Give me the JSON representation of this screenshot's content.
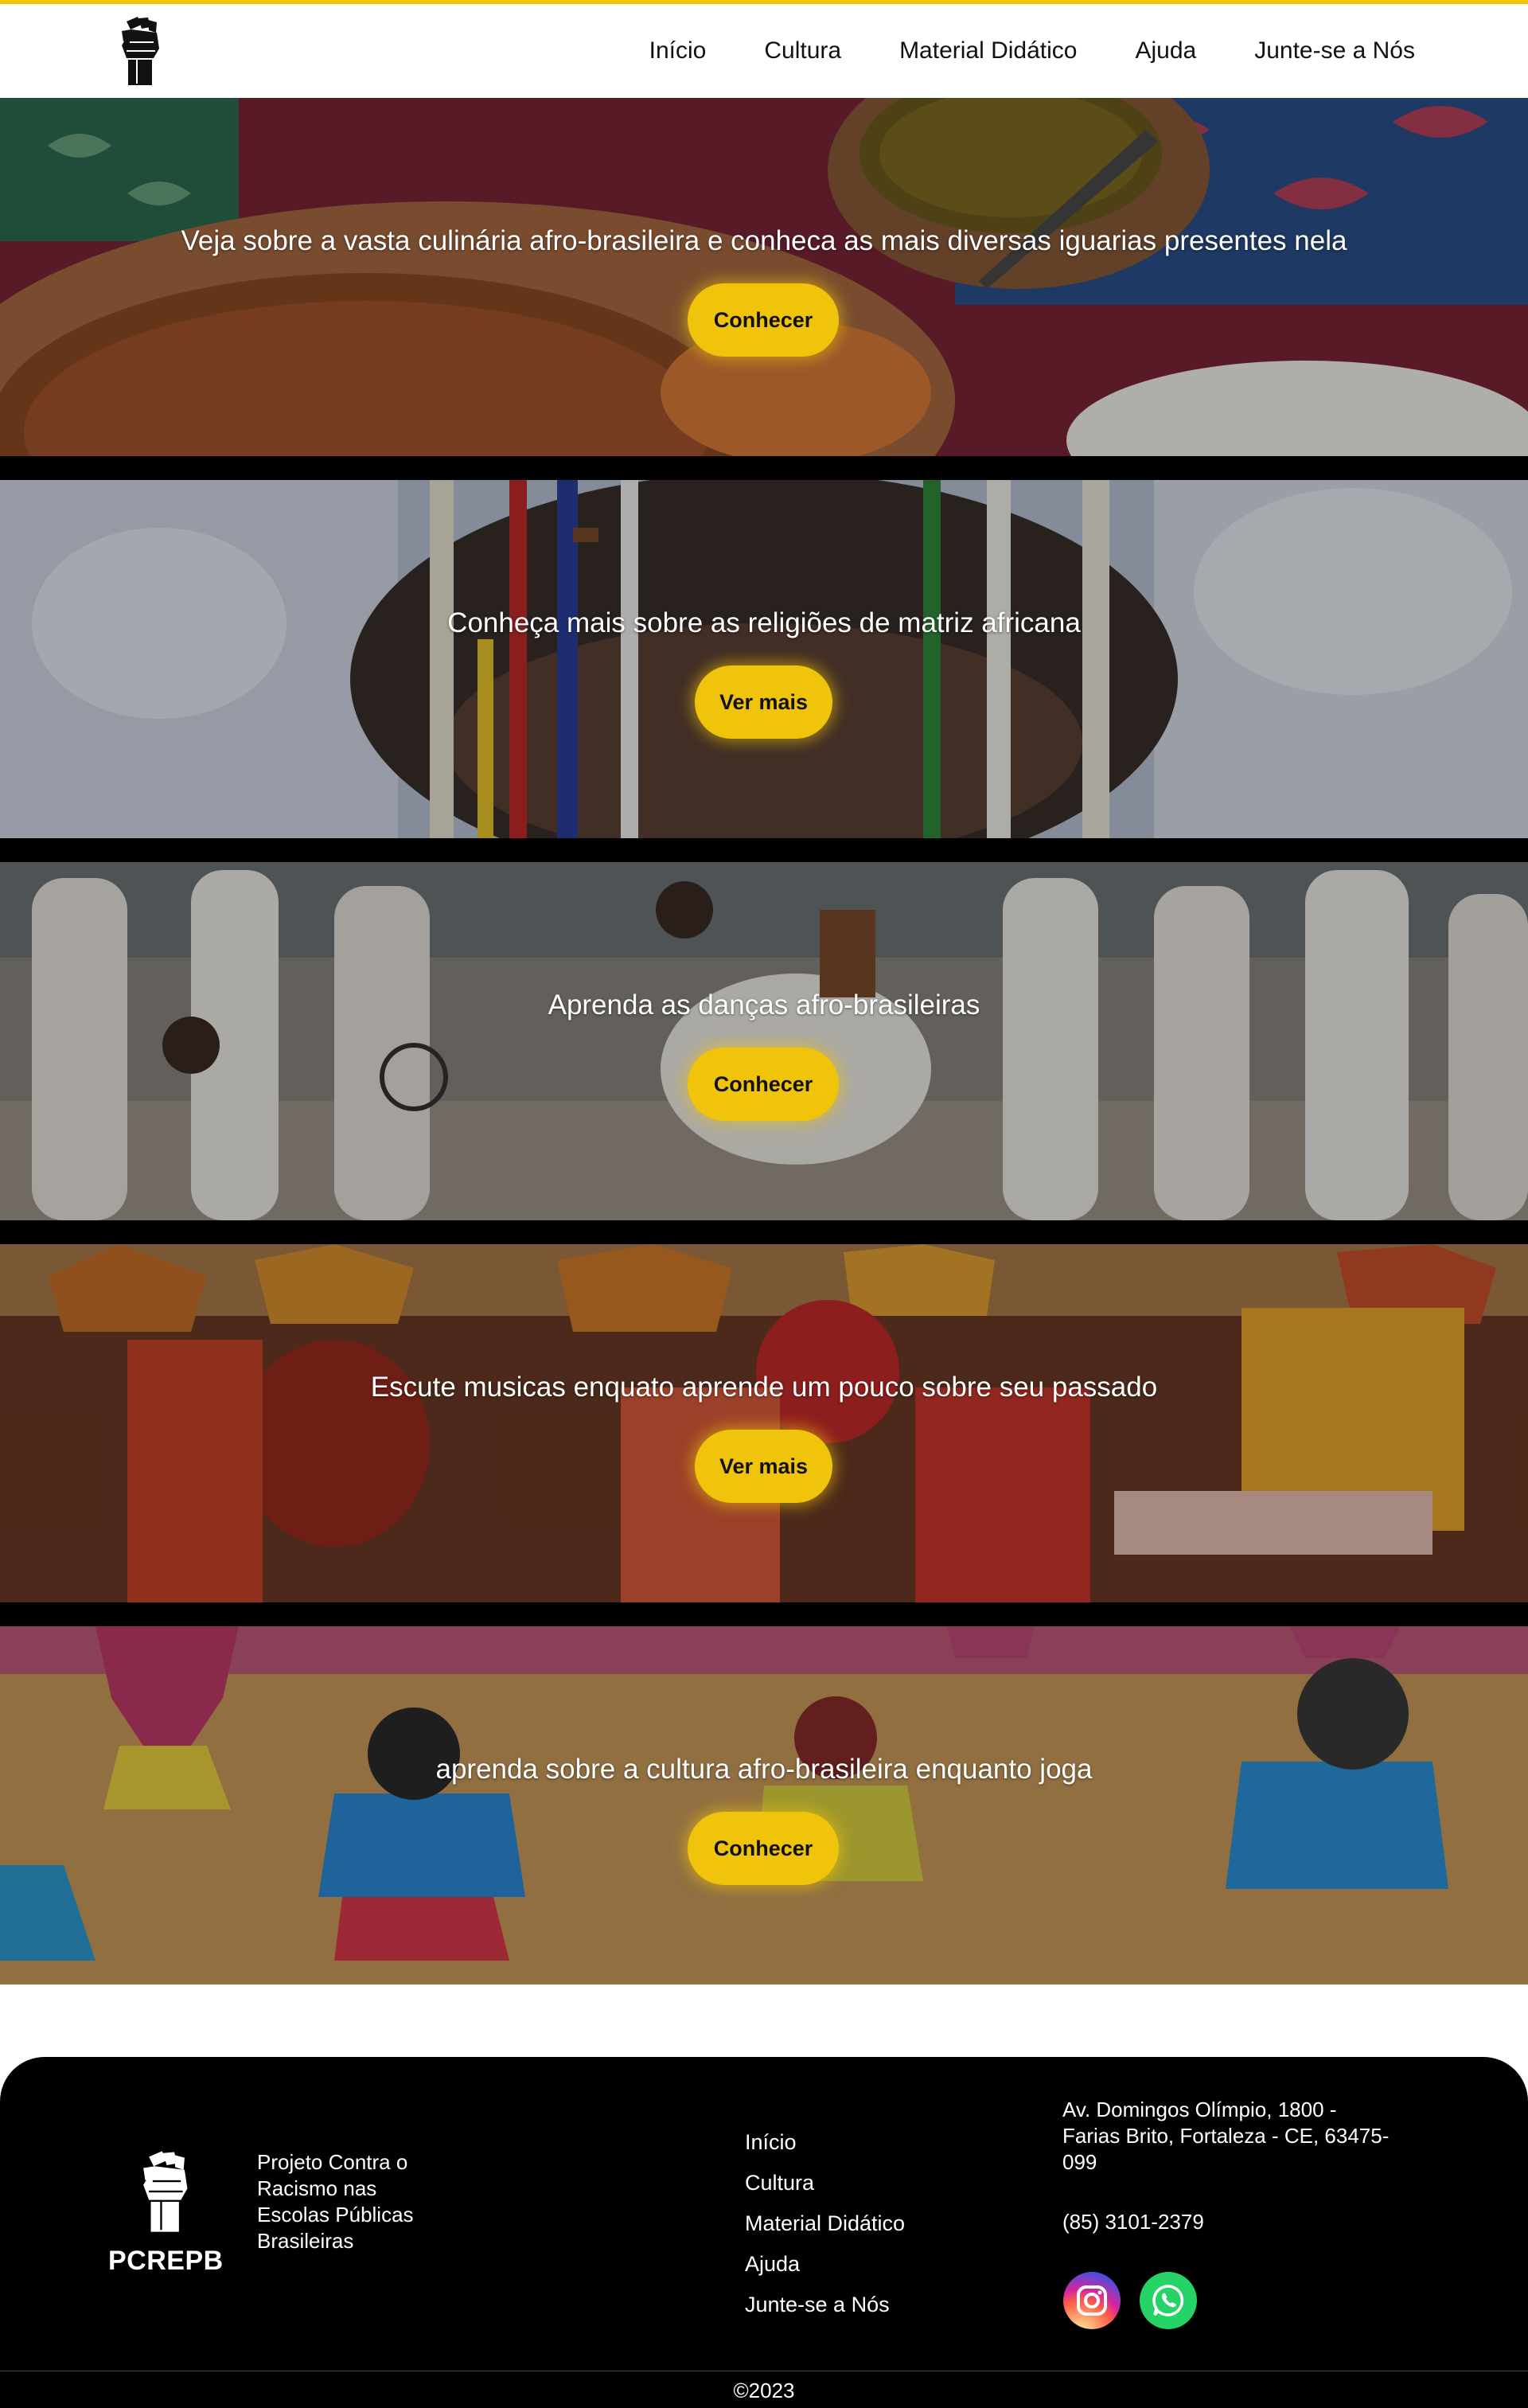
{
  "nav": {
    "items": [
      {
        "label": "Início"
      },
      {
        "label": "Cultura"
      },
      {
        "label": "Material Didático"
      },
      {
        "label": "Ajuda"
      },
      {
        "label": "Junte-se a Nós"
      }
    ]
  },
  "banners": [
    {
      "caption": "Veja sobre a vasta culinária afro-brasileira e conheca as mais diversas iguarias presentes nela",
      "button": "Conhecer"
    },
    {
      "caption": "Conheça mais sobre as religiões de matriz africana",
      "button": "Ver mais"
    },
    {
      "caption": "Aprenda as danças afro-brasileiras",
      "button": "Conhecer"
    },
    {
      "caption": "Escute musicas enquato aprende um pouco sobre seu passado",
      "button": "Ver mais"
    },
    {
      "caption": "aprenda sobre a cultura afro-brasileira enquanto joga",
      "button": "Conhecer"
    }
  ],
  "footer": {
    "brand": "PCREPB",
    "tagline": "Projeto Contra o Racismo nas Escolas Públicas Brasileiras",
    "links": [
      {
        "label": "Início"
      },
      {
        "label": "Cultura"
      },
      {
        "label": "Material Didático"
      },
      {
        "label": "Ajuda"
      },
      {
        "label": "Junte-se a Nós"
      }
    ],
    "address": "Av. Domingos Olímpio, 1800 - Farias Brito, Fortaleza - CE, 63475-099",
    "phone": "(85) 3101-2379",
    "social": [
      {
        "icon": "instagram-icon"
      },
      {
        "icon": "whatsapp-icon"
      }
    ],
    "copyright": "©2023"
  },
  "colors": {
    "accent": "#f2c300",
    "button": "#f0c40a",
    "footer_bg": "#000000",
    "whatsapp": "#25d366"
  }
}
